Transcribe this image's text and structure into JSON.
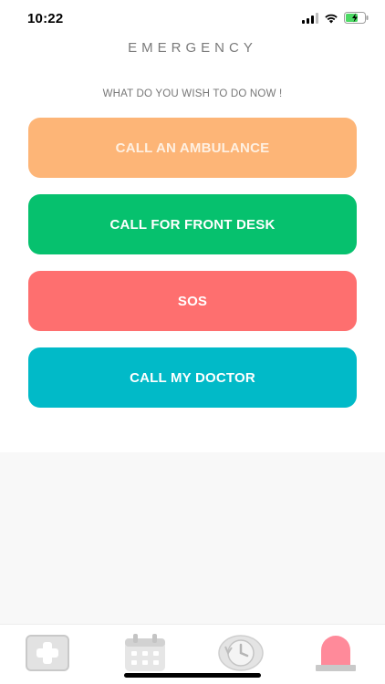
{
  "status_bar": {
    "time": "10:22",
    "icons": [
      "signal-icon",
      "wifi-icon",
      "battery-charging-icon"
    ]
  },
  "header": {
    "title": "EMERGENCY",
    "prompt": "WHAT  DO YOU WISH TO DO NOW !"
  },
  "actions": [
    {
      "label": "CALL AN AMBULANCE",
      "color": "#fdb577"
    },
    {
      "label": "CALL FOR FRONT DESK",
      "color": "#06c16e"
    },
    {
      "label": "SOS",
      "color": "#fe6f6f"
    },
    {
      "label": "CALL MY DOCTOR",
      "color": "#01bac8"
    }
  ],
  "tab_bar": {
    "tabs": [
      {
        "icon": "medical-cross-icon",
        "active": false
      },
      {
        "icon": "calendar-icon",
        "active": false
      },
      {
        "icon": "history-clock-icon",
        "active": false
      },
      {
        "icon": "emergency-siren-icon",
        "active": true
      }
    ],
    "active_color": "#ff8a9a",
    "inactive_color": "#d6d6d6"
  }
}
